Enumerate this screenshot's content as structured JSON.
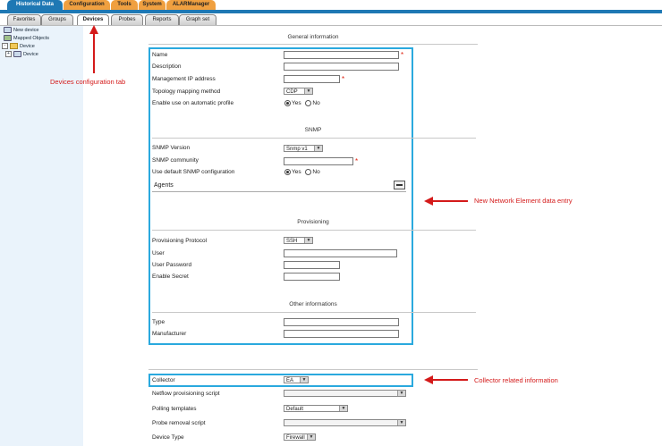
{
  "top_tabs": [
    "Historical Data",
    "Configuration",
    "Tools",
    "System",
    "ALARManager"
  ],
  "sub_tabs": [
    "Favorites",
    "Groups",
    "Devices",
    "Probes",
    "Reports",
    "Graph set"
  ],
  "tree": {
    "new_device": "New device",
    "mapped_objects": "Mapped Objects",
    "device_root": "Device",
    "device_child": "Device"
  },
  "sections": {
    "general": "General information",
    "snmp": "SNMP",
    "provisioning": "Provisioning",
    "other": "Other informations"
  },
  "general": {
    "name": "Name",
    "description": "Description",
    "mgmt_ip": "Management IP address",
    "topology": "Topology mapping method",
    "topology_value": "CDP",
    "auto_profile": "Enable use on automatic profile",
    "yes": "Yes",
    "no": "No"
  },
  "snmp": {
    "version": "SNMP Version",
    "version_value": "Snmp v1",
    "community": "SNMP community",
    "use_default": "Use default SNMP configuration",
    "yes": "Yes",
    "no": "No",
    "agents": "Agents"
  },
  "provisioning": {
    "protocol": "Provisioning Protocol",
    "protocol_value": "SSH",
    "user": "User",
    "password": "User Password",
    "enable_secret": "Enable Secret"
  },
  "other": {
    "type": "Type",
    "manufacturer": "Manufacturer"
  },
  "collector": {
    "collector": "Collector",
    "collector_value": "EA",
    "netflow": "Netflow provisioning script",
    "polling": "Polling templates",
    "polling_value": "Default",
    "probe_removal": "Probe removal script",
    "device_type": "Device Type",
    "device_type_value": "Firewall"
  },
  "annotations": {
    "devices_tab": "Devices configuration tab",
    "new_element": "New Network Element data entry",
    "collector_info": "Collector related information"
  },
  "colors": {
    "accent_blue": "#1e78b4",
    "highlight": "#2aa9de",
    "annotation_red": "#d41a1a",
    "tab_orange": "#f0a040"
  }
}
